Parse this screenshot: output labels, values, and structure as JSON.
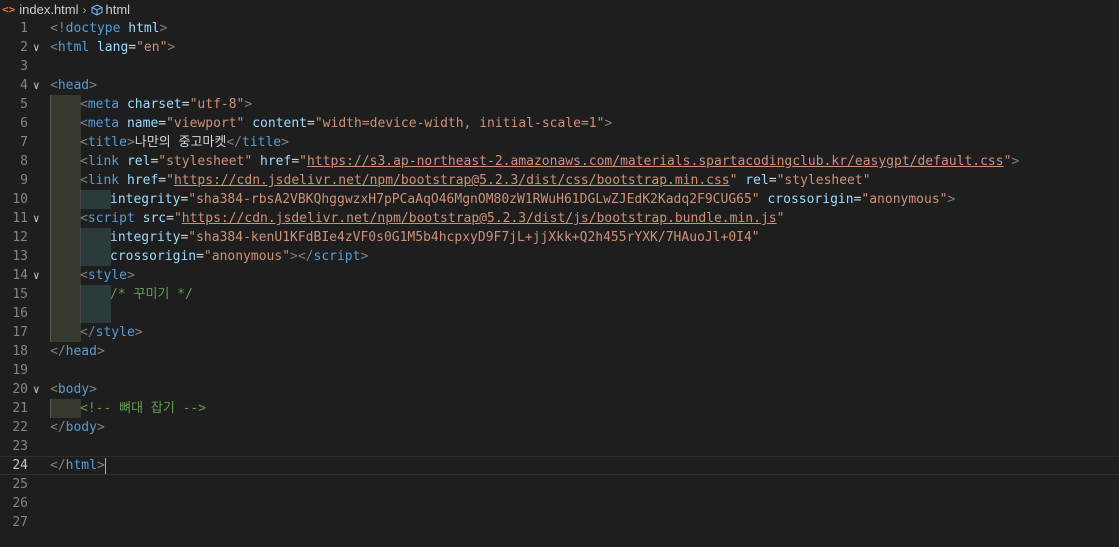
{
  "breadcrumb": {
    "file": "index.html",
    "symbol": "html"
  },
  "colors": {
    "background": "#1e1e1e",
    "tag": "#569cd6",
    "attribute": "#9cdcfe",
    "string": "#ce9178",
    "comment": "#6a9955"
  },
  "lines": [
    {
      "n": "1",
      "fold": "",
      "indent": 0,
      "tokens": [
        [
          "br",
          "<!"
        ],
        [
          "tag",
          "doctype"
        ],
        [
          "txt",
          " "
        ],
        [
          "attr",
          "html"
        ],
        [
          "br",
          ">"
        ]
      ]
    },
    {
      "n": "2",
      "fold": "v",
      "indent": 0,
      "tokens": [
        [
          "br",
          "<"
        ],
        [
          "tag",
          "html"
        ],
        [
          "txt",
          " "
        ],
        [
          "attr",
          "lang"
        ],
        [
          "txt",
          "="
        ],
        [
          "str",
          "\"en\""
        ],
        [
          "br",
          ">"
        ]
      ]
    },
    {
      "n": "3",
      "fold": "",
      "indent": 0,
      "tokens": []
    },
    {
      "n": "4",
      "fold": "v",
      "indent": 0,
      "tokens": [
        [
          "br",
          "<"
        ],
        [
          "tag",
          "head"
        ],
        [
          "br",
          ">"
        ]
      ]
    },
    {
      "n": "5",
      "fold": "",
      "indent": 1,
      "tokens": [
        [
          "br",
          "<"
        ],
        [
          "tag",
          "meta"
        ],
        [
          "txt",
          " "
        ],
        [
          "attr",
          "charset"
        ],
        [
          "txt",
          "="
        ],
        [
          "str",
          "\"utf-8\""
        ],
        [
          "br",
          ">"
        ]
      ]
    },
    {
      "n": "6",
      "fold": "",
      "indent": 1,
      "tokens": [
        [
          "br",
          "<"
        ],
        [
          "tag",
          "meta"
        ],
        [
          "txt",
          " "
        ],
        [
          "attr",
          "name"
        ],
        [
          "txt",
          "="
        ],
        [
          "str",
          "\"viewport\""
        ],
        [
          "txt",
          " "
        ],
        [
          "attr",
          "content"
        ],
        [
          "txt",
          "="
        ],
        [
          "str",
          "\"width=device-width, initial-scale=1\""
        ],
        [
          "br",
          ">"
        ]
      ]
    },
    {
      "n": "7",
      "fold": "",
      "indent": 1,
      "tokens": [
        [
          "br",
          "<"
        ],
        [
          "tag",
          "title"
        ],
        [
          "br",
          ">"
        ],
        [
          "txt",
          "나만의 중고마켓"
        ],
        [
          "br",
          "</"
        ],
        [
          "tag",
          "title"
        ],
        [
          "br",
          ">"
        ]
      ]
    },
    {
      "n": "8",
      "fold": "",
      "indent": 1,
      "tokens": [
        [
          "br",
          "<"
        ],
        [
          "tag",
          "link"
        ],
        [
          "txt",
          " "
        ],
        [
          "attr",
          "rel"
        ],
        [
          "txt",
          "="
        ],
        [
          "str",
          "\"stylesheet\""
        ],
        [
          "txt",
          " "
        ],
        [
          "attr",
          "href"
        ],
        [
          "txt",
          "="
        ],
        [
          "str",
          "\""
        ],
        [
          "url",
          "https://s3.ap-northeast-2.amazonaws.com/materials.spartacodingclub.kr/easygpt/default.css"
        ],
        [
          "str",
          "\""
        ],
        [
          "br",
          ">"
        ]
      ]
    },
    {
      "n": "9",
      "fold": "",
      "indent": 1,
      "tokens": [
        [
          "br",
          "<"
        ],
        [
          "tag",
          "link"
        ],
        [
          "txt",
          " "
        ],
        [
          "attr",
          "href"
        ],
        [
          "txt",
          "="
        ],
        [
          "str",
          "\""
        ],
        [
          "url",
          "https://cdn.jsdelivr.net/npm/bootstrap@5.2.3/dist/css/bootstrap.min.css"
        ],
        [
          "str",
          "\""
        ],
        [
          "txt",
          " "
        ],
        [
          "attr",
          "rel"
        ],
        [
          "txt",
          "="
        ],
        [
          "str",
          "\"stylesheet\""
        ]
      ]
    },
    {
      "n": "10",
      "fold": "",
      "indent": 2,
      "tokens": [
        [
          "attr",
          "integrity"
        ],
        [
          "txt",
          "="
        ],
        [
          "str",
          "\"sha384-rbsA2VBKQhggwzxH7pPCaAqO46MgnOM80zW1RWuH61DGLwZJEdK2Kadq2F9CUG65\""
        ],
        [
          "txt",
          " "
        ],
        [
          "attr",
          "crossorigin"
        ],
        [
          "txt",
          "="
        ],
        [
          "str",
          "\"anonymous\""
        ],
        [
          "br",
          ">"
        ]
      ]
    },
    {
      "n": "11",
      "fold": "v",
      "indent": 1,
      "tokens": [
        [
          "br",
          "<"
        ],
        [
          "tag",
          "script"
        ],
        [
          "txt",
          " "
        ],
        [
          "attr",
          "src"
        ],
        [
          "txt",
          "="
        ],
        [
          "str",
          "\""
        ],
        [
          "url",
          "https://cdn.jsdelivr.net/npm/bootstrap@5.2.3/dist/js/bootstrap.bundle.min.js"
        ],
        [
          "str",
          "\""
        ]
      ]
    },
    {
      "n": "12",
      "fold": "",
      "indent": 2,
      "tokens": [
        [
          "attr",
          "integrity"
        ],
        [
          "txt",
          "="
        ],
        [
          "str",
          "\"sha384-kenU1KFdBIe4zVF0s0G1M5b4hcpxyD9F7jL+jjXkk+Q2h455rYXK/7HAuoJl+0I4\""
        ]
      ]
    },
    {
      "n": "13",
      "fold": "",
      "indent": 2,
      "tokens": [
        [
          "attr",
          "crossorigin"
        ],
        [
          "txt",
          "="
        ],
        [
          "str",
          "\"anonymous\""
        ],
        [
          "br",
          "></"
        ],
        [
          "tag",
          "script"
        ],
        [
          "br",
          ">"
        ]
      ]
    },
    {
      "n": "14",
      "fold": "v",
      "indent": 1,
      "tokens": [
        [
          "br",
          "<"
        ],
        [
          "tag",
          "style"
        ],
        [
          "br",
          ">"
        ]
      ]
    },
    {
      "n": "15",
      "fold": "",
      "indent": 2,
      "tokens": [
        [
          "com",
          "/* 꾸미기 */"
        ]
      ]
    },
    {
      "n": "16",
      "fold": "",
      "indent": 2,
      "tokens": []
    },
    {
      "n": "17",
      "fold": "",
      "indent": 1,
      "tokens": [
        [
          "br",
          "</"
        ],
        [
          "tag",
          "style"
        ],
        [
          "br",
          ">"
        ]
      ]
    },
    {
      "n": "18",
      "fold": "",
      "indent": 0,
      "tokens": [
        [
          "br",
          "</"
        ],
        [
          "tag",
          "head"
        ],
        [
          "br",
          ">"
        ]
      ]
    },
    {
      "n": "19",
      "fold": "",
      "indent": 0,
      "tokens": []
    },
    {
      "n": "20",
      "fold": "v",
      "indent": 0,
      "tokens": [
        [
          "br",
          "<"
        ],
        [
          "tag",
          "body"
        ],
        [
          "br",
          ">"
        ]
      ]
    },
    {
      "n": "21",
      "fold": "",
      "indent": 1,
      "tokens": [
        [
          "com",
          "<!-- 뼈대 잡기 -->"
        ]
      ]
    },
    {
      "n": "22",
      "fold": "",
      "indent": 0,
      "tokens": [
        [
          "br",
          "</"
        ],
        [
          "tag",
          "body"
        ],
        [
          "br",
          ">"
        ]
      ]
    },
    {
      "n": "23",
      "fold": "",
      "indent": 0,
      "tokens": []
    },
    {
      "n": "24",
      "fold": "",
      "indent": 0,
      "current": true,
      "tokens": [
        [
          "br",
          "</"
        ],
        [
          "tag",
          "html"
        ],
        [
          "br",
          ">"
        ]
      ]
    },
    {
      "n": "25",
      "fold": "",
      "indent": 0,
      "tokens": []
    },
    {
      "n": "26",
      "fold": "",
      "indent": 0,
      "tokens": []
    },
    {
      "n": "27",
      "fold": "",
      "indent": 0,
      "tokens": []
    }
  ]
}
